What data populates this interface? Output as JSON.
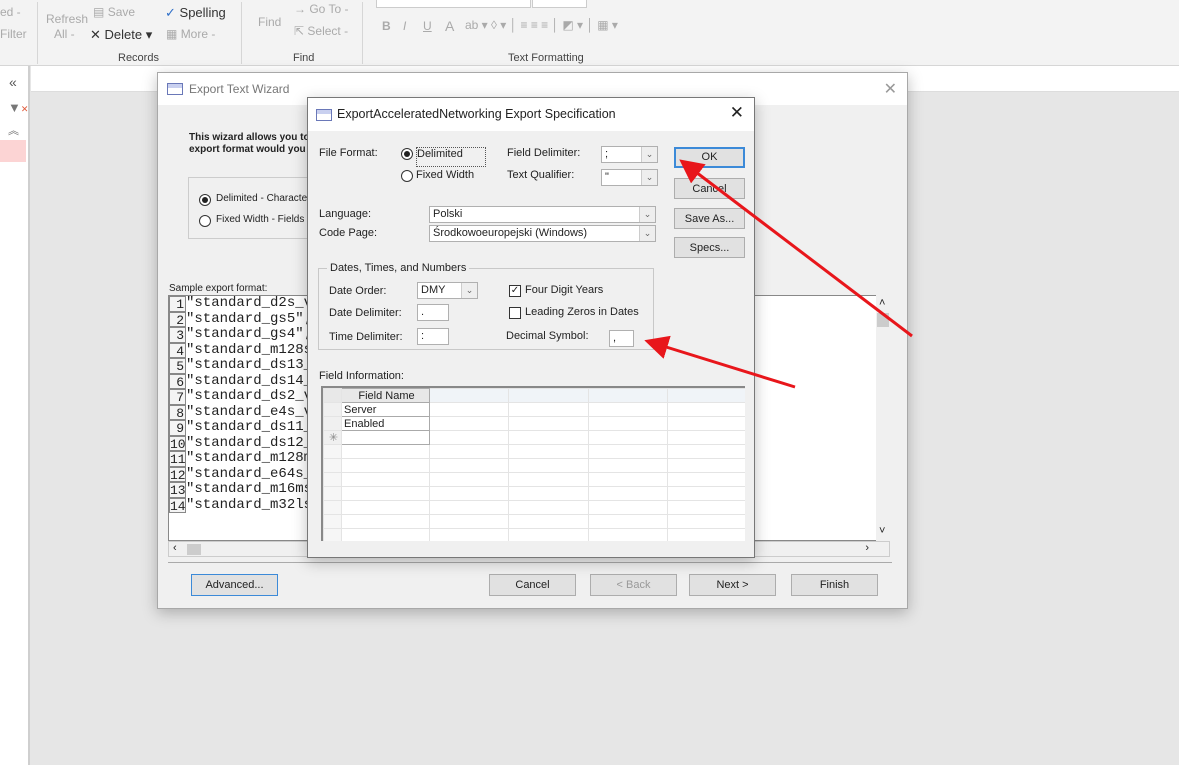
{
  "ribbon": {
    "left_partial": [
      "ed -",
      "Filter"
    ],
    "records": {
      "refresh": "Refresh",
      "all": "All -",
      "save": "Save",
      "delete": "Delete",
      "spelling": "Spelling",
      "more": "More -",
      "group": "Records"
    },
    "find": {
      "find": "Find",
      "goto": "→ Go To -",
      "select": "Select -",
      "group": "Find"
    },
    "text_formatting": {
      "group": "Text Formatting",
      "bold": "B",
      "italic": "I",
      "underline": "U",
      "font_color": "A"
    }
  },
  "nav": {
    "collapse": "«"
  },
  "wizard": {
    "title": "Export Text Wizard",
    "intro": [
      "This wizard allows you to",
      "export format would you li"
    ],
    "options": [
      {
        "label": "Delimited - Characte",
        "selected": true
      },
      {
        "label": "Fixed Width - Fields",
        "selected": false
      }
    ],
    "sample_label": "Sample export format:",
    "sample_rows": [
      "\"standard_d2s_v",
      "\"standard_gs5\";",
      "\"standard_gs4\";",
      "\"standard_m128s",
      "\"standard_ds13_",
      "\"standard_ds14_",
      "\"standard_ds2_v",
      "\"standard_e4s_v",
      "\"standard_ds11_",
      "\"standard_ds12_",
      "\"standard_m128m",
      "\"standard_e64s_",
      "\"standard_m16ms",
      "\"standard_m32ls"
    ],
    "buttons": {
      "advanced": "Advanced...",
      "cancel": "Cancel",
      "back": "< Back",
      "next": "Next >",
      "finish": "Finish"
    }
  },
  "spec": {
    "title": "ExportAcceleratedNetworking Export Specification",
    "file_format_label": "File Format:",
    "delimited": "Delimited",
    "fixed_width": "Fixed Width",
    "field_delimiter_label": "Field Delimiter:",
    "field_delimiter": ";",
    "text_qualifier_label": "Text Qualifier:",
    "text_qualifier": "\"",
    "language_label": "Language:",
    "language": "Polski",
    "code_page_label": "Code Page:",
    "code_page": "Środkowoeuropejski (Windows)",
    "group_title": "Dates, Times, and Numbers",
    "date_order_label": "Date Order:",
    "date_order": "DMY",
    "date_delimiter_label": "Date Delimiter:",
    "date_delimiter": ".",
    "time_delimiter_label": "Time Delimiter:",
    "time_delimiter": ":",
    "four_digit_years": "Four Digit Years",
    "four_digit_checked": true,
    "leading_zeros": "Leading Zeros in Dates",
    "leading_zeros_checked": false,
    "decimal_symbol_label": "Decimal Symbol:",
    "decimal_symbol": ",",
    "field_info_label": "Field Information:",
    "field_header": "Field Name",
    "fields": [
      "Server",
      "Enabled"
    ],
    "new_row_marker": "✳",
    "buttons": {
      "ok": "OK",
      "cancel": "Cancel",
      "save_as": "Save As...",
      "specs": "Specs..."
    }
  },
  "colors": {
    "arrow": "#e8161b",
    "ok_border": "#3c8ad8"
  }
}
